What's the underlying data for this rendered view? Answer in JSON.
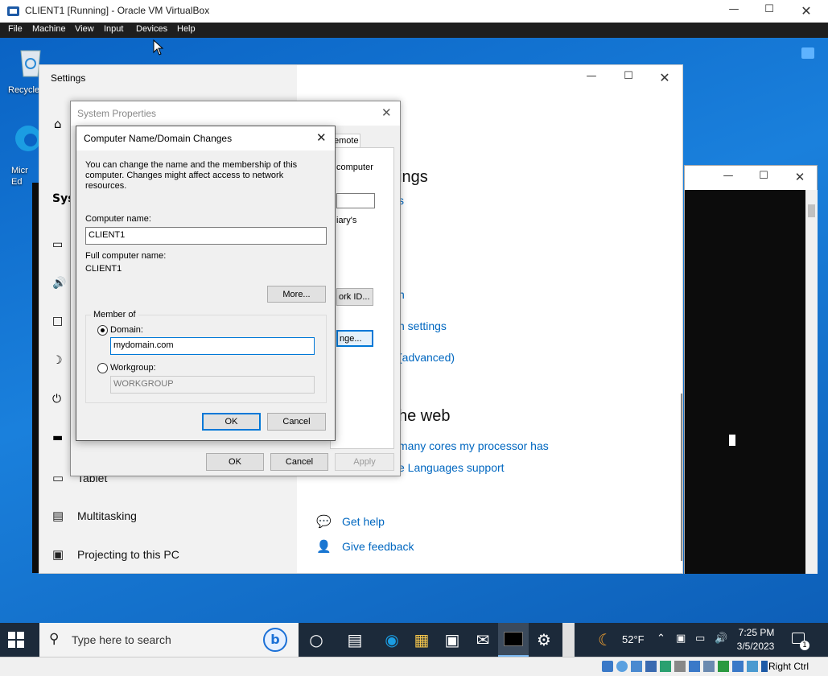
{
  "vbox": {
    "title": "CLIENT1 [Running] - Oracle VM VirtualBox",
    "menu": [
      "File",
      "Machine",
      "View",
      "Input",
      "Devices",
      "Help"
    ],
    "host_key": "Right Ctrl"
  },
  "desktop": {
    "icons": [
      "Recycle",
      "Micr\nEd"
    ]
  },
  "settings": {
    "title": "Settings",
    "nav_partial_head": "Sys",
    "nav": [
      {
        "label": "Tablet",
        "icon": "tablet-icon"
      },
      {
        "label": "Multitasking",
        "icon": "multitasking-icon"
      },
      {
        "label": "Projecting to this PC",
        "icon": "projecting-icon"
      }
    ],
    "right": {
      "heading1": "ings",
      "link1": "s",
      "link2": "n",
      "link3": "n settings",
      "link4": "(advanced)",
      "heading2": "he web",
      "web_link1": "many cores my processor has",
      "web_link2": "e Languages support",
      "help": "Get help",
      "feedback": "Give feedback"
    }
  },
  "sysprops": {
    "title": "System Properties",
    "tab_partial": "emote",
    "text_computer": "computer",
    "text_diary": "iary's",
    "network_id_btn": "ork ID...",
    "change_btn": "nge...",
    "ok": "OK",
    "cancel": "Cancel",
    "apply": "Apply"
  },
  "cnd": {
    "title": "Computer Name/Domain Changes",
    "description": "You can change the name and the membership of this computer. Changes might affect access to network resources.",
    "computer_name_label": "Computer name:",
    "computer_name_value": "CLIENT1",
    "full_name_label": "Full computer name:",
    "full_name_value": "CLIENT1",
    "more_btn": "More...",
    "member_of": "Member of",
    "domain_label": "Domain:",
    "domain_value": "mydomain.com",
    "workgroup_label": "Workgroup:",
    "workgroup_value": "WORKGROUP",
    "ok": "OK",
    "cancel": "Cancel"
  },
  "taskbar": {
    "search_placeholder": "Type here to search",
    "weather": "52°F",
    "time": "7:25 PM",
    "date": "3/5/2023",
    "notification_count": "1"
  }
}
